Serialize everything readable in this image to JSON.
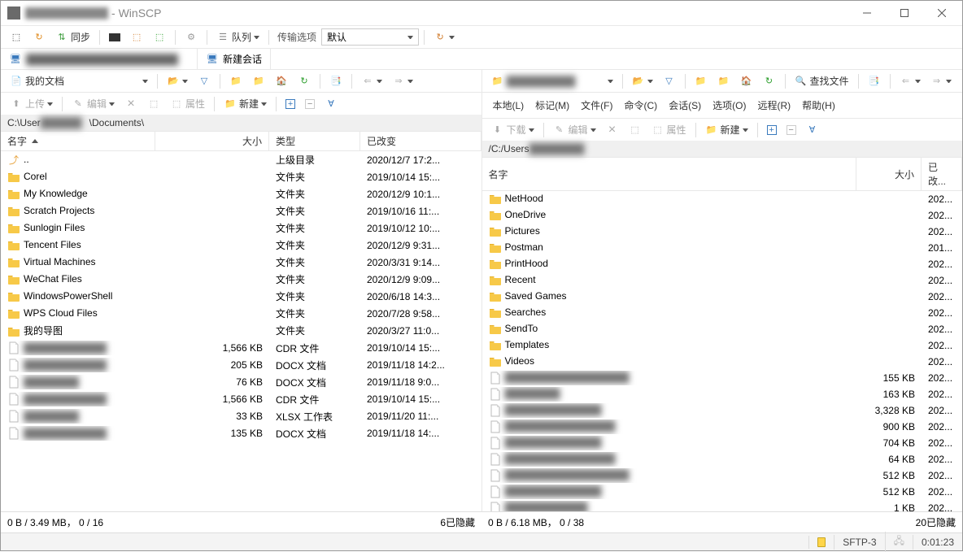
{
  "window": {
    "title_prefix_blur": "████████████",
    "title_suffix": " - WinSCP",
    "min": "–",
    "max": "□",
    "close": "×"
  },
  "toolbar1": {
    "sync": "同步",
    "queue": "队列",
    "transfer_options": "传输选项",
    "transfer_mode": "默认"
  },
  "session": {
    "tab_blur": "██████████████████████",
    "new_session": "新建会话"
  },
  "left": {
    "drive_label": "我的文档",
    "path_prefix": "C:\\User",
    "path_mid_blur": "██████",
    "path_suffix": "\\Documents\\",
    "upload": "上传",
    "edit": "编辑",
    "props": "属性",
    "new": "新建",
    "cols": {
      "name": "名字",
      "size": "大小",
      "type": "类型",
      "changed": "已改变"
    },
    "rows": [
      {
        "icon": "up",
        "name": "..",
        "size": "",
        "type": "上级目录",
        "changed": "2020/12/7  17:2..."
      },
      {
        "icon": "folder",
        "name": "Corel",
        "size": "",
        "type": "文件夹",
        "changed": "2019/10/14  15:..."
      },
      {
        "icon": "folder",
        "name": "My Knowledge",
        "size": "",
        "type": "文件夹",
        "changed": "2020/12/9  10:1..."
      },
      {
        "icon": "folder",
        "name": "Scratch Projects",
        "size": "",
        "type": "文件夹",
        "changed": "2019/10/16  11:..."
      },
      {
        "icon": "folder",
        "name": "Sunlogin Files",
        "size": "",
        "type": "文件夹",
        "changed": "2019/10/12  10:..."
      },
      {
        "icon": "folder",
        "name": "Tencent Files",
        "size": "",
        "type": "文件夹",
        "changed": "2020/12/9  9:31..."
      },
      {
        "icon": "folder",
        "name": "Virtual Machines",
        "size": "",
        "type": "文件夹",
        "changed": "2020/3/31  9:14..."
      },
      {
        "icon": "folder",
        "name": "WeChat Files",
        "size": "",
        "type": "文件夹",
        "changed": "2020/12/9  9:09..."
      },
      {
        "icon": "folder",
        "name": "WindowsPowerShell",
        "size": "",
        "type": "文件夹",
        "changed": "2020/6/18  14:3..."
      },
      {
        "icon": "folder",
        "name": "WPS Cloud Files",
        "size": "",
        "type": "文件夹",
        "changed": "2020/7/28  9:58..."
      },
      {
        "icon": "folder",
        "name": "我的导图",
        "size": "",
        "type": "文件夹",
        "changed": "2020/3/27  11:0..."
      },
      {
        "icon": "file",
        "name": "████████████",
        "blur": true,
        "size": "1,566 KB",
        "type": "CDR 文件",
        "changed": "2019/10/14  15:..."
      },
      {
        "icon": "file",
        "name": "████████████",
        "blur": true,
        "size": "205 KB",
        "type": "DOCX 文档",
        "changed": "2019/11/18  14:2..."
      },
      {
        "icon": "file",
        "name": "████████",
        "blur": true,
        "size": "76 KB",
        "type": "DOCX 文档",
        "changed": "2019/11/18  9:0..."
      },
      {
        "icon": "file",
        "name": "████████████",
        "blur": true,
        "size": "1,566 KB",
        "type": "CDR 文件",
        "changed": "2019/10/14  15:..."
      },
      {
        "icon": "file",
        "name": "████████",
        "blur": true,
        "size": "33 KB",
        "type": "XLSX 工作表",
        "changed": "2019/11/20  11:..."
      },
      {
        "icon": "file",
        "name": "████████████",
        "blur": true,
        "size": "135 KB",
        "type": "DOCX 文档",
        "changed": "2019/11/18  14:..."
      }
    ],
    "status_left": "0 B / 3.49 MB，  0 / 16",
    "status_right": "6已隐藏"
  },
  "right": {
    "drive_blur": "██████████",
    "menus": [
      "本地(L)",
      "标记(M)",
      "文件(F)",
      "命令(C)",
      "会话(S)",
      "选项(O)",
      "远程(R)",
      "帮助(H)"
    ],
    "find": "查找文件",
    "download": "下载",
    "edit": "编辑",
    "props": "属性",
    "new": "新建",
    "path_prefix": "/C:/Users",
    "path_blur": "████████",
    "cols": {
      "name": "名字",
      "size": "大小",
      "changed": "已改..."
    },
    "rows": [
      {
        "icon": "folder",
        "name": "NetHood",
        "size": "",
        "changed": "202..."
      },
      {
        "icon": "folder",
        "name": "OneDrive",
        "size": "",
        "changed": "202..."
      },
      {
        "icon": "folder",
        "name": "Pictures",
        "size": "",
        "changed": "202..."
      },
      {
        "icon": "folder",
        "name": "Postman",
        "size": "",
        "changed": "201..."
      },
      {
        "icon": "folder",
        "name": "PrintHood",
        "size": "",
        "changed": "202..."
      },
      {
        "icon": "folder",
        "name": "Recent",
        "size": "",
        "changed": "202..."
      },
      {
        "icon": "folder",
        "name": "Saved Games",
        "size": "",
        "changed": "202..."
      },
      {
        "icon": "folder",
        "name": "Searches",
        "size": "",
        "changed": "202..."
      },
      {
        "icon": "folder",
        "name": "SendTo",
        "size": "",
        "changed": "202..."
      },
      {
        "icon": "folder",
        "name": "Templates",
        "size": "",
        "changed": "202..."
      },
      {
        "icon": "folder",
        "name": "Videos",
        "size": "",
        "changed": "202..."
      },
      {
        "icon": "file",
        "name": "██████████████████",
        "blur": true,
        "size": "155 KB",
        "changed": "202..."
      },
      {
        "icon": "file",
        "name": "████████",
        "blur": true,
        "size": "163 KB",
        "changed": "202..."
      },
      {
        "icon": "file",
        "name": "██████████████",
        "blur": true,
        "size": "3,328 KB",
        "changed": "202..."
      },
      {
        "icon": "file",
        "name": "████████████████",
        "blur": true,
        "size": "900 KB",
        "changed": "202..."
      },
      {
        "icon": "file",
        "name": "██████████████",
        "blur": true,
        "size": "704 KB",
        "changed": "202..."
      },
      {
        "icon": "file",
        "name": "████████████████",
        "blur": true,
        "size": "64 KB",
        "changed": "202..."
      },
      {
        "icon": "file",
        "name": "██████████████████",
        "blur": true,
        "size": "512 KB",
        "changed": "202..."
      },
      {
        "icon": "file",
        "name": "██████████████",
        "blur": true,
        "size": "512 KB",
        "changed": "202..."
      },
      {
        "icon": "file",
        "name": "████████████",
        "blur": true,
        "size": "1 KB",
        "changed": "202..."
      }
    ],
    "status_left": "0 B / 6.18 MB，  0 / 38",
    "status_right": "20已隐藏"
  },
  "bottom": {
    "protocol": "SFTP-3",
    "time": "0:01:23"
  },
  "icons": {
    "folder_svg": "folder"
  }
}
